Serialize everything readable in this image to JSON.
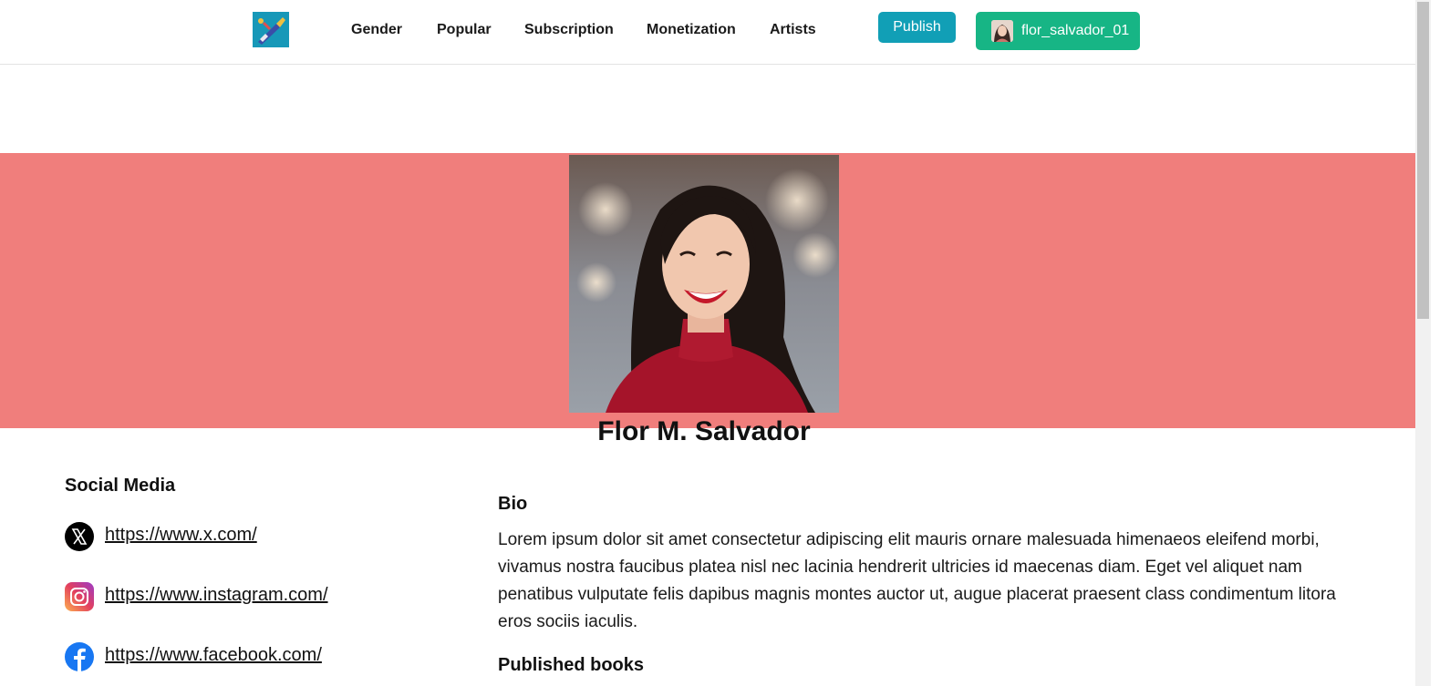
{
  "nav": {
    "logo_icon": "paintbrush-logo-icon",
    "links": [
      "Gender",
      "Popular",
      "Subscription",
      "Monetization",
      "Artists"
    ],
    "publish_label": "Publish",
    "user": {
      "username": "flor_salvador_01",
      "avatar_icon": "user-avatar-icon"
    }
  },
  "colors": {
    "banner": "#f07e7c",
    "publish_button": "#119fb6",
    "user_button": "#17b585"
  },
  "profile": {
    "name": "Flor M. Salvador",
    "photo_icon": "profile-photo"
  },
  "social": {
    "title": "Social Media",
    "items": [
      {
        "icon": "x-icon",
        "url": "https://www.x.com/"
      },
      {
        "icon": "instagram-icon",
        "url": "https://www.instagram.com/"
      },
      {
        "icon": "facebook-icon",
        "url": "https://www.facebook.com/"
      }
    ]
  },
  "bio": {
    "title": "Bio",
    "text": "Lorem ipsum dolor sit amet consectetur adipiscing elit mauris ornare malesuada himenaeos eleifend morbi, vivamus nostra faucibus platea nisl nec lacinia hendrerit ultricies id maecenas diam. Eget vel aliquet nam penatibus vulputate felis dapibus magnis montes auctor ut, augue placerat praesent class condimentum litora eros sociis iaculis."
  },
  "books": {
    "title": "Published books"
  }
}
